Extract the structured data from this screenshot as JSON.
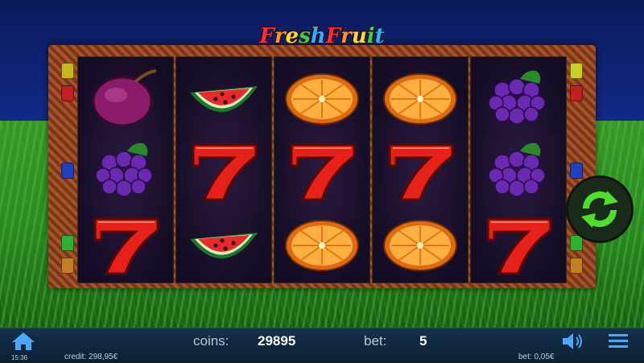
{
  "game": {
    "title": "Fresh Fruit"
  },
  "reels": [
    [
      "plum",
      "grapes",
      "seven"
    ],
    [
      "watermelon",
      "seven",
      "watermelon"
    ],
    [
      "orange",
      "seven",
      "orange"
    ],
    [
      "orange",
      "seven",
      "orange"
    ],
    [
      "grapes",
      "grapes",
      "seven"
    ]
  ],
  "controls": {
    "refresh_icon": "spin-refresh-icon"
  },
  "footer": {
    "coins_label": "coins:",
    "coins_value": "29895",
    "bet_label": "bet:",
    "bet_value": "5",
    "time": "15:36",
    "credit": "credit: 298,95€",
    "bet_money": "bet: 0,05€"
  },
  "colors": {
    "sky": "#0a1a5a",
    "frame": "#8a4420",
    "refresh_green": "#3fcf2a",
    "footer_bg": "#14304a"
  }
}
